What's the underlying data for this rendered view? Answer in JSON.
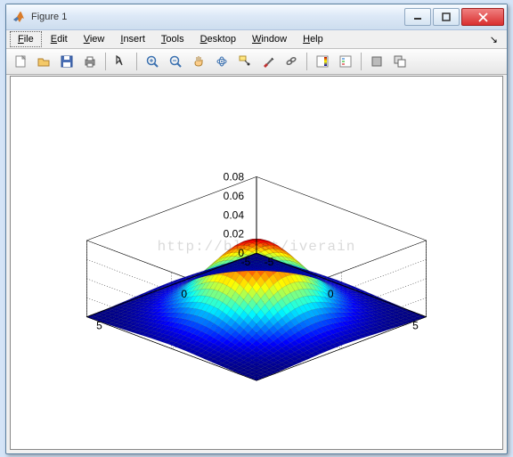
{
  "window": {
    "title": "Figure 1"
  },
  "menu": {
    "file": "File",
    "edit": "Edit",
    "view": "View",
    "insert": "Insert",
    "tools": "Tools",
    "desktop": "Desktop",
    "window": "Window",
    "help": "Help"
  },
  "toolbar": {
    "new": "New Figure",
    "open": "Open",
    "save": "Save",
    "print": "Print",
    "edit_plot": "Edit Plot",
    "zoom_in": "Zoom In",
    "zoom_out": "Zoom Out",
    "pan": "Pan",
    "rotate": "Rotate 3D",
    "data_cursor": "Data Cursor",
    "brush": "Brush",
    "link": "Link",
    "colorbar": "Insert Colorbar",
    "legend": "Insert Legend",
    "hide": "Hide Plot Tools",
    "show": "Show Plot Tools"
  },
  "watermark": "http://blo          et/iverain",
  "chart_data": {
    "type": "surface",
    "description": "3D mesh plot of a 2-D Gaussian: z = A * exp(-(x^2+y^2)/(2*sigma^2))",
    "x_range": [
      -5,
      5
    ],
    "y_range": [
      -5,
      5
    ],
    "x_ticks": [
      -5,
      0,
      5
    ],
    "y_ticks": [
      -5,
      0,
      5
    ],
    "z_range": [
      0,
      0.08
    ],
    "z_ticks": [
      0,
      0.02,
      0.04,
      0.06,
      0.08
    ],
    "amplitude": 0.0795,
    "sigma": 2.0,
    "colormap": "jet",
    "view": {
      "azimuth": -37.5,
      "elevation": 30
    }
  }
}
